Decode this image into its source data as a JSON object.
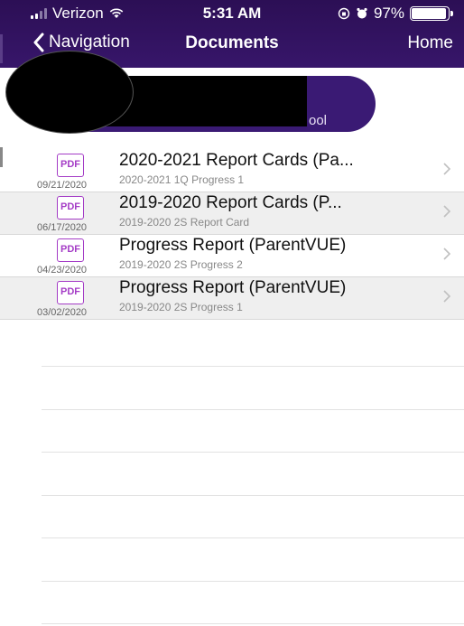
{
  "status_bar": {
    "carrier": "Verizon",
    "time": "5:31 AM",
    "battery": "97%",
    "battery_level": 0.97
  },
  "nav_bar": {
    "back_label": "Navigation",
    "title": "Documents",
    "home_label": "Home"
  },
  "school_banner": {
    "label_partial": "ool"
  },
  "documents": [
    {
      "date": "09/21/2020",
      "icon_label": "PDF",
      "title": "2020-2021 Report Cards (Pa...",
      "subtitle": "2020-2021 1Q Progress 1"
    },
    {
      "date": "06/17/2020",
      "icon_label": "PDF",
      "title": "2019-2020 Report Cards (P...",
      "subtitle": "2019-2020 2S Report Card"
    },
    {
      "date": "04/23/2020",
      "icon_label": "PDF",
      "title": "Progress Report (ParentVUE)",
      "subtitle": "2019-2020 2S Progress 2"
    },
    {
      "date": "03/02/2020",
      "icon_label": "PDF",
      "title": "Progress Report (ParentVUE)",
      "subtitle": "2019-2020 2S Progress 1"
    }
  ],
  "colors": {
    "header_purple": "#2c0f55",
    "pdf_purple": "#a43cc6",
    "alt_row_gray": "#efefef"
  }
}
